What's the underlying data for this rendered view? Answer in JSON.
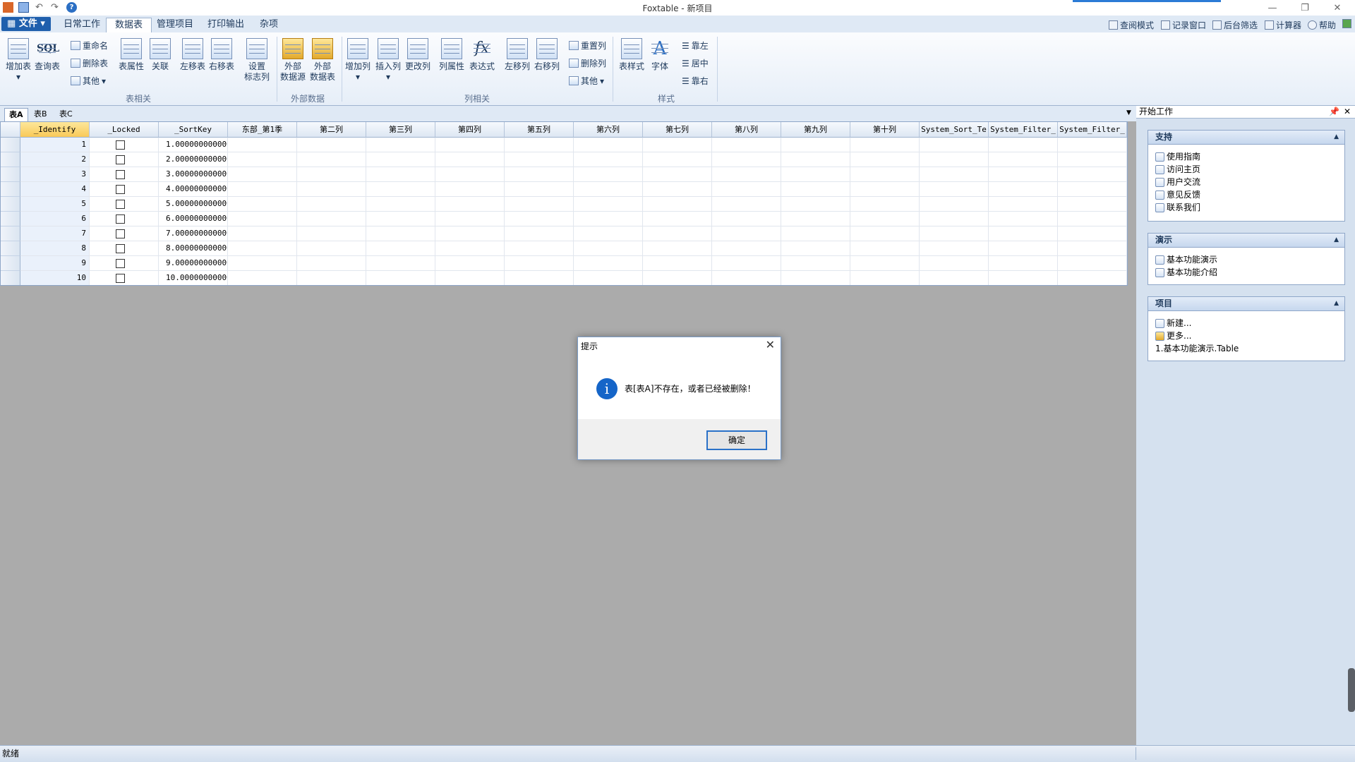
{
  "app": {
    "title": "Foxtable - 新项目"
  },
  "ribbon": {
    "file_label": "文件",
    "tabs": [
      {
        "label": "日常工作"
      },
      {
        "label": "数据表"
      },
      {
        "label": "管理项目"
      },
      {
        "label": "打印输出"
      },
      {
        "label": "杂项"
      }
    ],
    "active_tab": "数据表",
    "right_tools": [
      "查阅模式",
      "记录窗口",
      "后台筛选",
      "计算器",
      "帮助"
    ],
    "buttons": {
      "add_table": "增加表",
      "query_table": "查询表",
      "rename": "重命名",
      "delete_table": "删除表",
      "other": "其他",
      "table_props": "表属性",
      "relation": "关联",
      "move_left_table": "左移表",
      "move_right_table": "右移表",
      "set_flag_col": "设置\n标志列",
      "ext_source": "外部\n数据源",
      "ext_table": "外部\n数据表",
      "add_col": "增加列",
      "insert_col": "插入列",
      "change_col": "更改列",
      "col_props": "列属性",
      "expression": "表达式",
      "move_left_col": "左移列",
      "move_right_col": "右移列",
      "reset_col": "重置列",
      "delete_col": "删除列",
      "other2": "其他",
      "table_style": "表样式",
      "font": "字体",
      "align_left": "靠左",
      "align_center": "居中",
      "align_right": "靠右"
    },
    "groups": {
      "table": "表相关",
      "external": "外部数据",
      "column": "列相关",
      "style": "样式"
    }
  },
  "sheet_tabs": [
    "表A",
    "表B",
    "表C"
  ],
  "grid": {
    "columns": [
      "_Identify",
      "_Locked",
      "_SortKey",
      "东部_第1季",
      "第二列",
      "第三列",
      "第四列",
      "第五列",
      "第六列",
      "第七列",
      "第八列",
      "第九列",
      "第十列",
      "System_Sort_Te",
      "System_Filter_",
      "System_Filter_"
    ],
    "rows": [
      {
        "id": "1",
        "sortkey": "1.000000000000"
      },
      {
        "id": "2",
        "sortkey": "2.000000000000"
      },
      {
        "id": "3",
        "sortkey": "3.000000000000"
      },
      {
        "id": "4",
        "sortkey": "4.000000000000"
      },
      {
        "id": "5",
        "sortkey": "5.000000000000"
      },
      {
        "id": "6",
        "sortkey": "6.000000000000"
      },
      {
        "id": "7",
        "sortkey": "7.000000000000"
      },
      {
        "id": "8",
        "sortkey": "8.000000000000"
      },
      {
        "id": "9",
        "sortkey": "9.000000000000"
      },
      {
        "id": "10",
        "sortkey": "10.00000000000"
      }
    ]
  },
  "panel": {
    "title": "开始工作",
    "support": {
      "header": "支持",
      "items": [
        "使用指南",
        "访问主页",
        "用户交流",
        "意见反馈",
        "联系我们"
      ]
    },
    "demo": {
      "header": "演示",
      "items": [
        "基本功能演示",
        "基本功能介绍"
      ]
    },
    "project": {
      "header": "项目",
      "items": [
        "新建...",
        "更多...",
        "1.基本功能演示.Table"
      ]
    }
  },
  "status": {
    "text": "就绪"
  },
  "dialog": {
    "title": "提示",
    "message": "表[表A]不存在，或者已经被删除！",
    "ok_label": "确定",
    "icon": "i"
  }
}
